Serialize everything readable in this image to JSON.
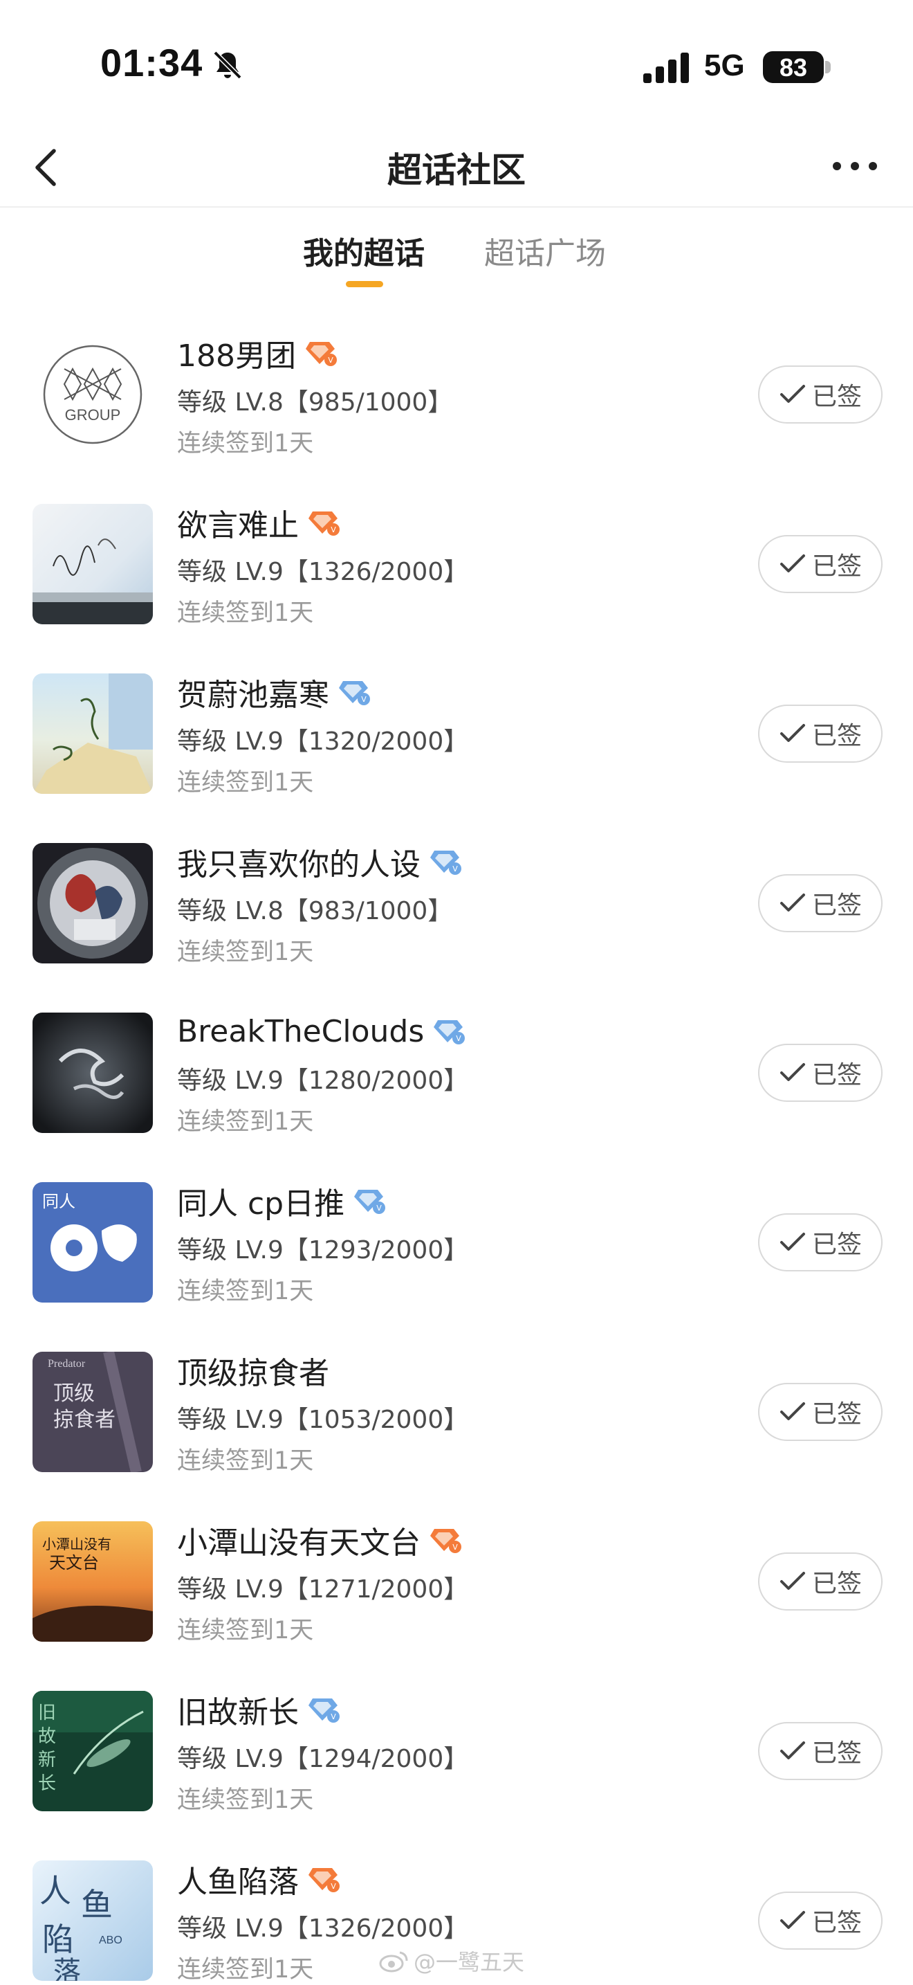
{
  "status_bar": {
    "time": "01:34",
    "network": "5G",
    "battery": "83",
    "bell_icon": "bell-slash-icon",
    "signal_icon": "signal-bars-icon"
  },
  "nav": {
    "title": "超话社区",
    "back_icon": "chevron-left-icon",
    "more_icon": "more-dots-icon"
  },
  "tabs": [
    {
      "label": "我的超话",
      "active": true
    },
    {
      "label": "超话广场",
      "active": false
    }
  ],
  "accent_color": "#f5a623",
  "items": [
    {
      "name": "188男团",
      "level": "等级 LV.8【985/1000】",
      "streak": "连续签到1天",
      "badge": "已签",
      "rank": "orange"
    },
    {
      "name": "欲言难止",
      "level": "等级 LV.9【1326/2000】",
      "streak": "连续签到1天",
      "badge": "已签",
      "rank": "orange"
    },
    {
      "name": "贺蔚池嘉寒",
      "level": "等级 LV.9【1320/2000】",
      "streak": "连续签到1天",
      "badge": "已签",
      "rank": "blue"
    },
    {
      "name": "我只喜欢你的人设",
      "level": "等级 LV.8【983/1000】",
      "streak": "连续签到1天",
      "badge": "已签",
      "rank": "blue"
    },
    {
      "name": "BreakTheClouds",
      "level": "等级 LV.9【1280/2000】",
      "streak": "连续签到1天",
      "badge": "已签",
      "rank": "blue"
    },
    {
      "name": "同人 cp日推",
      "level": "等级 LV.9【1293/2000】",
      "streak": "连续签到1天",
      "badge": "已签",
      "rank": "blue"
    },
    {
      "name": "顶级掠食者",
      "level": "等级 LV.9【1053/2000】",
      "streak": "连续签到1天",
      "badge": "已签",
      "rank": "none"
    },
    {
      "name": "小潭山没有天文台",
      "level": "等级 LV.9【1271/2000】",
      "streak": "连续签到1天",
      "badge": "已签",
      "rank": "orange"
    },
    {
      "name": "旧故新长",
      "level": "等级 LV.9【1294/2000】",
      "streak": "连续签到1天",
      "badge": "已签",
      "rank": "blue"
    },
    {
      "name": "人鱼陷落",
      "level": "等级 LV.9【1326/2000】",
      "streak": "连续签到1天",
      "badge": "已签",
      "rank": "orange"
    }
  ],
  "thumbnail_texts": {
    "group_logo": "GROUP",
    "predator_en": "Predator",
    "predator_cn": "顶级\n掠食者",
    "tanshan": "小潭山没有\n天文台",
    "jiugu": "旧故新长",
    "renyu": "人鱼陷落",
    "renyu_sub": "ABO",
    "tongren": "同人"
  },
  "watermark": "@一鹭五天"
}
